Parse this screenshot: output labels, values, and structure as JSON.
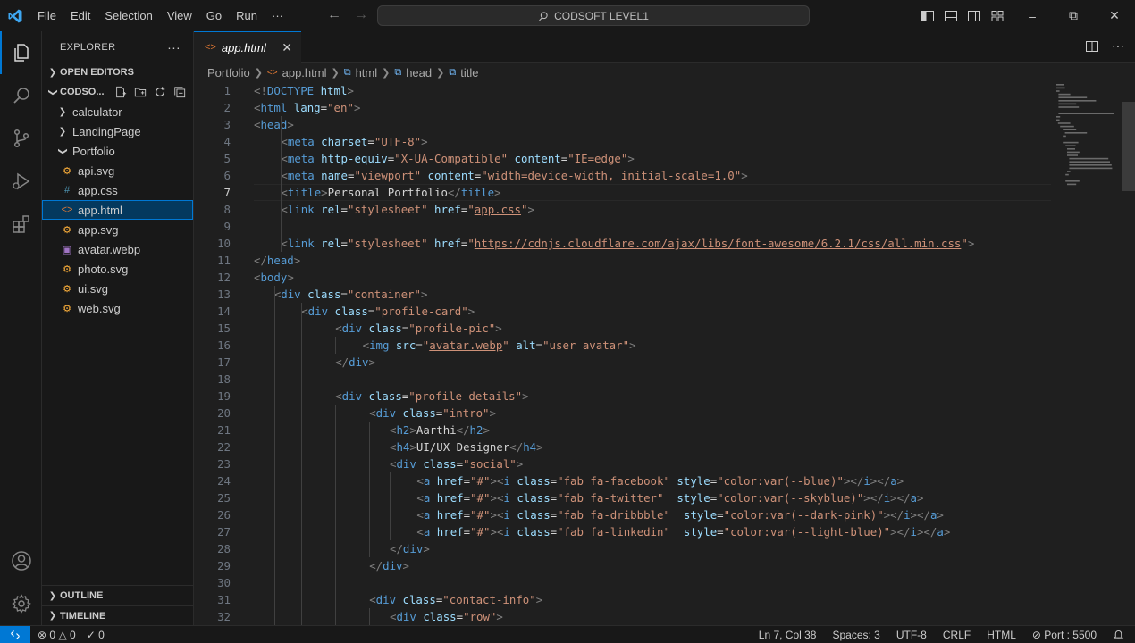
{
  "titlebar": {
    "menu": [
      "File",
      "Edit",
      "Selection",
      "View",
      "Go",
      "Run",
      "···"
    ],
    "search_text": "CODSOFT LEVEL1",
    "back_icon": "arrow-left-icon",
    "forward_icon": "arrow-right-icon",
    "layout_icons": [
      "toggle-primary-sidebar-icon",
      "toggle-panel-icon",
      "toggle-secondary-sidebar-icon",
      "customize-layout-icon"
    ],
    "window_controls": [
      "–",
      "⧉",
      "✕"
    ]
  },
  "activitybar": {
    "items": [
      "explorer-icon",
      "search-icon",
      "source-control-icon",
      "run-debug-icon",
      "extensions-icon"
    ],
    "bottom": [
      "accounts-icon",
      "manage-gear-icon"
    ]
  },
  "sidebar": {
    "title": "EXPLORER",
    "more": "···",
    "open_editors": "OPEN EDITORS",
    "workspace": "CODSO...",
    "tree": [
      {
        "label": "calculator",
        "type": "folder",
        "indent": 1,
        "expanded": false
      },
      {
        "label": "LandingPage",
        "type": "folder",
        "indent": 1,
        "expanded": false
      },
      {
        "label": "Portfolio",
        "type": "folder",
        "indent": 1,
        "expanded": true
      },
      {
        "label": "api.svg",
        "type": "svg",
        "indent": 2
      },
      {
        "label": "app.css",
        "type": "css",
        "indent": 2
      },
      {
        "label": "app.html",
        "type": "html",
        "indent": 2,
        "selected": true
      },
      {
        "label": "app.svg",
        "type": "svg",
        "indent": 2
      },
      {
        "label": "avatar.webp",
        "type": "image",
        "indent": 2
      },
      {
        "label": "photo.svg",
        "type": "svg",
        "indent": 2
      },
      {
        "label": "ui.svg",
        "type": "svg",
        "indent": 2
      },
      {
        "label": "web.svg",
        "type": "svg",
        "indent": 2
      }
    ],
    "outline": "OUTLINE",
    "timeline": "TIMELINE"
  },
  "editor": {
    "tab_label": "app.html",
    "tab_close": "✕",
    "breadcrumb": [
      "Portfolio",
      "app.html",
      "html",
      "head",
      "title"
    ],
    "current_line": 7,
    "lines": [
      {
        "n": 1,
        "indent": 0,
        "tokens": [
          [
            "t",
            "<!"
          ],
          [
            "n",
            "DOCTYPE"
          ],
          [
            "a",
            " html"
          ],
          [
            "t",
            ">"
          ]
        ]
      },
      {
        "n": 2,
        "indent": 0,
        "tokens": [
          [
            "t",
            "<"
          ],
          [
            "n",
            "html"
          ],
          [
            "a",
            " lang"
          ],
          [
            "p",
            "="
          ],
          [
            "s",
            "\"en\""
          ],
          [
            "t",
            ">"
          ]
        ]
      },
      {
        "n": 3,
        "indent": 0,
        "tokens": [
          [
            "t",
            "<"
          ],
          [
            "n",
            "head"
          ],
          [
            "t",
            ">"
          ]
        ]
      },
      {
        "n": 4,
        "indent": 4,
        "tokens": [
          [
            "t",
            "<"
          ],
          [
            "n",
            "meta"
          ],
          [
            "a",
            " charset"
          ],
          [
            "p",
            "="
          ],
          [
            "s",
            "\"UTF-8\""
          ],
          [
            "t",
            ">"
          ]
        ]
      },
      {
        "n": 5,
        "indent": 4,
        "tokens": [
          [
            "t",
            "<"
          ],
          [
            "n",
            "meta"
          ],
          [
            "a",
            " http-equiv"
          ],
          [
            "p",
            "="
          ],
          [
            "s",
            "\"X-UA-Compatible\""
          ],
          [
            "a",
            " content"
          ],
          [
            "p",
            "="
          ],
          [
            "s",
            "\"IE=edge\""
          ],
          [
            "t",
            ">"
          ]
        ]
      },
      {
        "n": 6,
        "indent": 4,
        "tokens": [
          [
            "t",
            "<"
          ],
          [
            "n",
            "meta"
          ],
          [
            "a",
            " name"
          ],
          [
            "p",
            "="
          ],
          [
            "s",
            "\"viewport\""
          ],
          [
            "a",
            " content"
          ],
          [
            "p",
            "="
          ],
          [
            "s",
            "\"width=device-width, initial-scale=1.0\""
          ],
          [
            "t",
            ">"
          ]
        ]
      },
      {
        "n": 7,
        "indent": 4,
        "tokens": [
          [
            "t",
            "<"
          ],
          [
            "n",
            "title"
          ],
          [
            "t",
            ">"
          ],
          [
            "p",
            "Personal Portfolio"
          ],
          [
            "t",
            "</"
          ],
          [
            "n",
            "title"
          ],
          [
            "t",
            ">"
          ]
        ]
      },
      {
        "n": 8,
        "indent": 4,
        "tokens": [
          [
            "t",
            "<"
          ],
          [
            "n",
            "link"
          ],
          [
            "a",
            " rel"
          ],
          [
            "p",
            "="
          ],
          [
            "s",
            "\"stylesheet\""
          ],
          [
            "a",
            " href"
          ],
          [
            "p",
            "="
          ],
          [
            "s",
            "\""
          ],
          [
            "u",
            "app.css"
          ],
          [
            "s",
            "\""
          ],
          [
            "t",
            ">"
          ]
        ]
      },
      {
        "n": 9,
        "indent": 0,
        "tokens": []
      },
      {
        "n": 10,
        "indent": 4,
        "tokens": [
          [
            "t",
            "<"
          ],
          [
            "n",
            "link"
          ],
          [
            "a",
            " rel"
          ],
          [
            "p",
            "="
          ],
          [
            "s",
            "\"stylesheet\""
          ],
          [
            "a",
            " href"
          ],
          [
            "p",
            "="
          ],
          [
            "s",
            "\""
          ],
          [
            "u",
            "https://cdnjs.cloudflare.com/ajax/libs/font-awesome/6.2.1/css/all.min.css"
          ],
          [
            "s",
            "\""
          ],
          [
            "t",
            ">"
          ]
        ]
      },
      {
        "n": 11,
        "indent": 0,
        "tokens": [
          [
            "t",
            "</"
          ],
          [
            "n",
            "head"
          ],
          [
            "t",
            ">"
          ]
        ]
      },
      {
        "n": 12,
        "indent": 0,
        "tokens": [
          [
            "t",
            "<"
          ],
          [
            "n",
            "body"
          ],
          [
            "t",
            ">"
          ]
        ]
      },
      {
        "n": 13,
        "indent": 3,
        "tokens": [
          [
            "t",
            "<"
          ],
          [
            "n",
            "div"
          ],
          [
            "a",
            " class"
          ],
          [
            "p",
            "="
          ],
          [
            "s",
            "\"container\""
          ],
          [
            "t",
            ">"
          ]
        ]
      },
      {
        "n": 14,
        "indent": 7,
        "tokens": [
          [
            "t",
            "<"
          ],
          [
            "n",
            "div"
          ],
          [
            "a",
            " class"
          ],
          [
            "p",
            "="
          ],
          [
            "s",
            "\"profile-card\""
          ],
          [
            "t",
            ">"
          ]
        ]
      },
      {
        "n": 15,
        "indent": 12,
        "tokens": [
          [
            "t",
            "<"
          ],
          [
            "n",
            "div"
          ],
          [
            "a",
            " class"
          ],
          [
            "p",
            "="
          ],
          [
            "s",
            "\"profile-pic\""
          ],
          [
            "t",
            ">"
          ]
        ]
      },
      {
        "n": 16,
        "indent": 16,
        "tokens": [
          [
            "t",
            "<"
          ],
          [
            "n",
            "img"
          ],
          [
            "a",
            " src"
          ],
          [
            "p",
            "="
          ],
          [
            "s",
            "\""
          ],
          [
            "u",
            "avatar.webp"
          ],
          [
            "s",
            "\""
          ],
          [
            "a",
            " alt"
          ],
          [
            "p",
            "="
          ],
          [
            "s",
            "\"user avatar\""
          ],
          [
            "t",
            ">"
          ]
        ]
      },
      {
        "n": 17,
        "indent": 12,
        "tokens": [
          [
            "t",
            "</"
          ],
          [
            "n",
            "div"
          ],
          [
            "t",
            ">"
          ]
        ]
      },
      {
        "n": 18,
        "indent": 0,
        "tokens": []
      },
      {
        "n": 19,
        "indent": 12,
        "tokens": [
          [
            "t",
            "<"
          ],
          [
            "n",
            "div"
          ],
          [
            "a",
            " class"
          ],
          [
            "p",
            "="
          ],
          [
            "s",
            "\"profile-details\""
          ],
          [
            "t",
            ">"
          ]
        ]
      },
      {
        "n": 20,
        "indent": 17,
        "tokens": [
          [
            "t",
            "<"
          ],
          [
            "n",
            "div"
          ],
          [
            "a",
            " class"
          ],
          [
            "p",
            "="
          ],
          [
            "s",
            "\"intro\""
          ],
          [
            "t",
            ">"
          ]
        ]
      },
      {
        "n": 21,
        "indent": 20,
        "tokens": [
          [
            "t",
            "<"
          ],
          [
            "n",
            "h2"
          ],
          [
            "t",
            ">"
          ],
          [
            "p",
            "Aarthi"
          ],
          [
            "t",
            "</"
          ],
          [
            "n",
            "h2"
          ],
          [
            "t",
            ">"
          ]
        ]
      },
      {
        "n": 22,
        "indent": 20,
        "tokens": [
          [
            "t",
            "<"
          ],
          [
            "n",
            "h4"
          ],
          [
            "t",
            ">"
          ],
          [
            "p",
            "UI/UX Designer"
          ],
          [
            "t",
            "</"
          ],
          [
            "n",
            "h4"
          ],
          [
            "t",
            ">"
          ]
        ]
      },
      {
        "n": 23,
        "indent": 20,
        "tokens": [
          [
            "t",
            "<"
          ],
          [
            "n",
            "div"
          ],
          [
            "a",
            " class"
          ],
          [
            "p",
            "="
          ],
          [
            "s",
            "\"social\""
          ],
          [
            "t",
            ">"
          ]
        ]
      },
      {
        "n": 24,
        "indent": 24,
        "tokens": [
          [
            "t",
            "<"
          ],
          [
            "n",
            "a"
          ],
          [
            "a",
            " href"
          ],
          [
            "p",
            "="
          ],
          [
            "s",
            "\"#\""
          ],
          [
            "t",
            "><"
          ],
          [
            "n",
            "i"
          ],
          [
            "a",
            " class"
          ],
          [
            "p",
            "="
          ],
          [
            "s",
            "\"fab fa-facebook\""
          ],
          [
            "a",
            " style"
          ],
          [
            "p",
            "="
          ],
          [
            "s",
            "\"color:var(--blue)\""
          ],
          [
            "t",
            "></"
          ],
          [
            "n",
            "i"
          ],
          [
            "t",
            "></"
          ],
          [
            "n",
            "a"
          ],
          [
            "t",
            ">"
          ]
        ]
      },
      {
        "n": 25,
        "indent": 24,
        "tokens": [
          [
            "t",
            "<"
          ],
          [
            "n",
            "a"
          ],
          [
            "a",
            " href"
          ],
          [
            "p",
            "="
          ],
          [
            "s",
            "\"#\""
          ],
          [
            "t",
            "><"
          ],
          [
            "n",
            "i"
          ],
          [
            "a",
            " class"
          ],
          [
            "p",
            "="
          ],
          [
            "s",
            "\"fab fa-twitter\""
          ],
          [
            "a",
            "  style"
          ],
          [
            "p",
            "="
          ],
          [
            "s",
            "\"color:var(--skyblue)\""
          ],
          [
            "t",
            "></"
          ],
          [
            "n",
            "i"
          ],
          [
            "t",
            "></"
          ],
          [
            "n",
            "a"
          ],
          [
            "t",
            ">"
          ]
        ]
      },
      {
        "n": 26,
        "indent": 24,
        "tokens": [
          [
            "t",
            "<"
          ],
          [
            "n",
            "a"
          ],
          [
            "a",
            " href"
          ],
          [
            "p",
            "="
          ],
          [
            "s",
            "\"#\""
          ],
          [
            "t",
            "><"
          ],
          [
            "n",
            "i"
          ],
          [
            "a",
            " class"
          ],
          [
            "p",
            "="
          ],
          [
            "s",
            "\"fab fa-dribbble\""
          ],
          [
            "a",
            "  style"
          ],
          [
            "p",
            "="
          ],
          [
            "s",
            "\"color:var(--dark-pink)\""
          ],
          [
            "t",
            "></"
          ],
          [
            "n",
            "i"
          ],
          [
            "t",
            "></"
          ],
          [
            "n",
            "a"
          ],
          [
            "t",
            ">"
          ]
        ]
      },
      {
        "n": 27,
        "indent": 24,
        "tokens": [
          [
            "t",
            "<"
          ],
          [
            "n",
            "a"
          ],
          [
            "a",
            " href"
          ],
          [
            "p",
            "="
          ],
          [
            "s",
            "\"#\""
          ],
          [
            "t",
            "><"
          ],
          [
            "n",
            "i"
          ],
          [
            "a",
            " class"
          ],
          [
            "p",
            "="
          ],
          [
            "s",
            "\"fab fa-linkedin\""
          ],
          [
            "a",
            "  style"
          ],
          [
            "p",
            "="
          ],
          [
            "s",
            "\"color:var(--light-blue)\""
          ],
          [
            "t",
            "></"
          ],
          [
            "n",
            "i"
          ],
          [
            "t",
            "></"
          ],
          [
            "n",
            "a"
          ],
          [
            "t",
            ">"
          ]
        ]
      },
      {
        "n": 28,
        "indent": 20,
        "tokens": [
          [
            "t",
            "</"
          ],
          [
            "n",
            "div"
          ],
          [
            "t",
            ">"
          ]
        ]
      },
      {
        "n": 29,
        "indent": 17,
        "tokens": [
          [
            "t",
            "</"
          ],
          [
            "n",
            "div"
          ],
          [
            "t",
            ">"
          ]
        ]
      },
      {
        "n": 30,
        "indent": 0,
        "tokens": []
      },
      {
        "n": 31,
        "indent": 17,
        "tokens": [
          [
            "t",
            "<"
          ],
          [
            "n",
            "div"
          ],
          [
            "a",
            " class"
          ],
          [
            "p",
            "="
          ],
          [
            "s",
            "\"contact-info\""
          ],
          [
            "t",
            ">"
          ]
        ]
      },
      {
        "n": 32,
        "indent": 20,
        "tokens": [
          [
            "t",
            "<"
          ],
          [
            "n",
            "div"
          ],
          [
            "a",
            " class"
          ],
          [
            "p",
            "="
          ],
          [
            "s",
            "\"row\""
          ],
          [
            "t",
            ">"
          ]
        ]
      }
    ]
  },
  "statusbar": {
    "remote_icon": "remote-icon",
    "errors": "0",
    "warnings": "0",
    "ports": "0",
    "position": "Ln 7, Col 38",
    "spaces": "Spaces: 3",
    "encoding": "UTF-8",
    "eol": "CRLF",
    "language": "HTML",
    "port": "Port : 5500",
    "bell_icon": "notifications-bell-icon"
  },
  "colors": {
    "accent": "#0078d4",
    "tag_bracket": "#808080",
    "tag_name": "#569cd6",
    "attribute": "#9cdcfe",
    "string": "#ce9178",
    "text": "#d4d4d4"
  }
}
